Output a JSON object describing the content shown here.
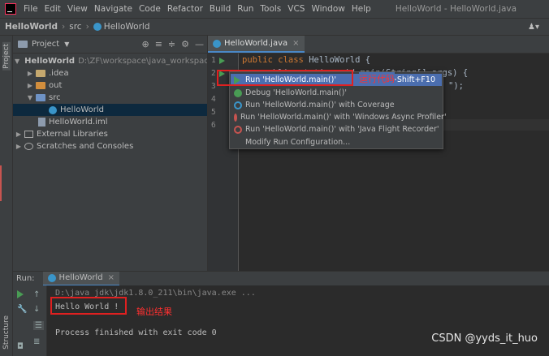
{
  "menu": {
    "items": [
      "File",
      "Edit",
      "View",
      "Navigate",
      "Code",
      "Refactor",
      "Build",
      "Run",
      "Tools",
      "VCS",
      "Window",
      "Help"
    ],
    "window_title": "HelloWorld - HelloWorld.java"
  },
  "breadcrumb": {
    "project": "HelloWorld",
    "folder": "src",
    "file": "HelloWorld"
  },
  "side_tabs": {
    "project": "Project",
    "structure": "Structure"
  },
  "project_panel": {
    "header": "Project",
    "tree": [
      {
        "label": "HelloWorld",
        "extra": "D:\\ZF\\workspace\\java_workspace\\Je"
      },
      {
        "label": ".idea"
      },
      {
        "label": "out"
      },
      {
        "label": "src"
      },
      {
        "label": "HelloWorld"
      },
      {
        "label": "HelloWorld.iml"
      },
      {
        "label": "External Libraries"
      },
      {
        "label": "Scratches and Consoles"
      }
    ]
  },
  "editor": {
    "tab_label": "HelloWorld.java",
    "line_numbers": [
      "1",
      "2",
      "3",
      "4",
      "5",
      "6"
    ],
    "code": {
      "line1_kw": "public class ",
      "line1_rest": "HelloWorld {",
      "line2_visible": "    public static void main(String[] args) {",
      "line3_visible": "\");"
    }
  },
  "context_menu": {
    "items": [
      {
        "label": "Run 'HelloWorld.main()'",
        "shortcut": "Ctrl+Shift+F10"
      },
      {
        "label": "Debug 'HelloWorld.main()'"
      },
      {
        "label": "Run 'HelloWorld.main()' with Coverage"
      },
      {
        "label": "Run 'HelloWorld.main()' with 'Windows Async Profiler'"
      },
      {
        "label": "Run 'HelloWorld.main()' with 'Java Flight Recorder'"
      },
      {
        "label": "Modify Run Configuration..."
      }
    ]
  },
  "annotations": {
    "run_code": "运行代码",
    "output_result": "输出结果"
  },
  "run_panel": {
    "label": "Run:",
    "tab_label": "HelloWorld",
    "console": [
      "D:\\java_jdk\\jdk1.8.0_211\\bin\\java.exe ...",
      "Hello World !",
      "",
      "Process finished with exit code 0"
    ]
  },
  "watermark": "CSDN @yyds_it_huo",
  "colors": {
    "run_green": "#499c54",
    "selection_blue": "#4b6eaf",
    "annotation_red": "#e02020"
  }
}
